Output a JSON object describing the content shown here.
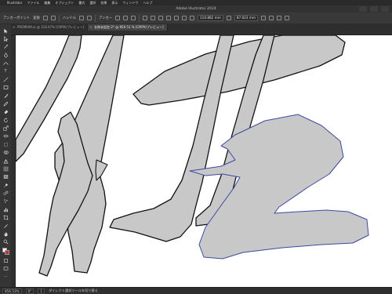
{
  "menubar": {
    "apple": "",
    "items": [
      "Illustrator",
      "ファイル",
      "編集",
      "オブジェクト",
      "書式",
      "選択",
      "効果",
      "表示",
      "ウィンドウ",
      "ヘルプ"
    ],
    "right": ""
  },
  "window": {
    "title": "Adobe Illustrator 2024"
  },
  "control": {
    "anchor_points_label": "アンカーポイント",
    "convert_label": "変換",
    "handle_label": "ハンドル",
    "anchor_label": "アンカー",
    "x_value": "110.882 mm",
    "y_value": "87.023 mm"
  },
  "tabs": [
    {
      "label": "PREMIUM.ai @ 118.47% [CMYK/プレビュー]",
      "active": false
    },
    {
      "label": "名称未設定-2* @ 856.53 % [CMYK/プレビュー]",
      "active": true
    }
  ],
  "status": {
    "zoom": "856.53%",
    "angle": "0°",
    "artboard": "1",
    "tool_hint": "ダイレクト選択ツールを切り替え"
  },
  "colors": {
    "shape_fill": "#c8c8c8",
    "shape_stroke": "#111111",
    "selection": "#3b4aa0",
    "stroke_swatch": "#c3352b"
  }
}
